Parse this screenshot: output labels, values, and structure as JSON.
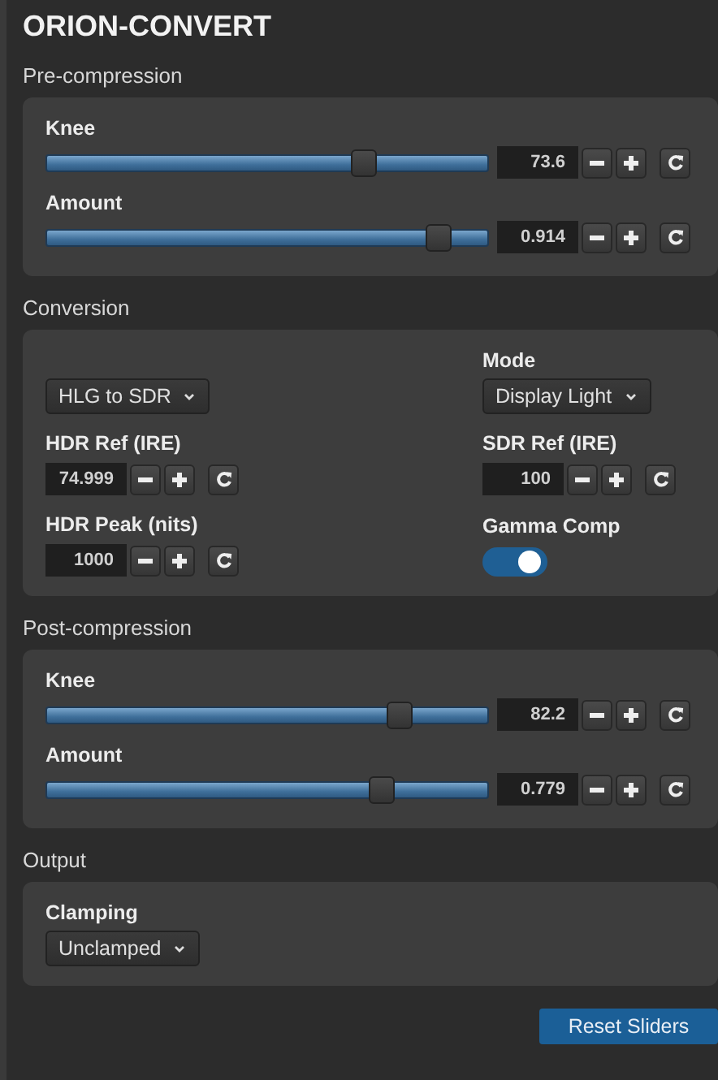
{
  "title": "ORION-CONVERT",
  "sections": [
    {
      "kind": "sliders",
      "heading": "Pre-compression",
      "sliders": [
        {
          "label": "Knee",
          "level": 0.72,
          "value": "73.6"
        },
        {
          "label": "Amount",
          "level": 0.89,
          "value": "0.914"
        }
      ]
    },
    {
      "kind": "grid",
      "heading": "Conversion",
      "fields": [
        {
          "kind": "select",
          "value": "HLG to SDR"
        },
        {
          "kind": "number",
          "label": "HDR Ref (IRE)",
          "value": "74.999"
        },
        {
          "kind": "number",
          "label": "HDR Peak (nits)",
          "value": "1000"
        },
        {
          "kind": "select",
          "label": "Mode",
          "value": "Display Light"
        },
        {
          "kind": "number",
          "label": "SDR Ref (IRE)",
          "value": "100"
        },
        {
          "kind": "toggle",
          "label": "Gamma Comp",
          "on": true
        }
      ]
    },
    {
      "kind": "sliders",
      "heading": "Post-compression",
      "sliders": [
        {
          "label": "Knee",
          "level": 0.8,
          "value": "82.2"
        },
        {
          "label": "Amount",
          "level": 0.76,
          "value": "0.779"
        }
      ]
    },
    {
      "kind": "grid",
      "heading": "Output",
      "fields": [
        {
          "kind": "select",
          "label": "Clamping",
          "value": "Unclamped"
        }
      ]
    }
  ],
  "reset_button": "Reset Sliders"
}
